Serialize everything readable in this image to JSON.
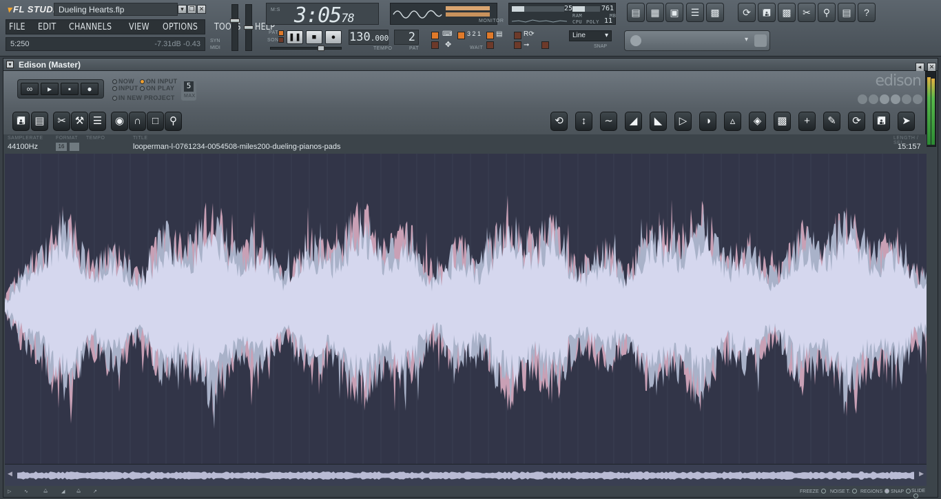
{
  "app": {
    "logo": "FL STUDIO",
    "project": "Dueling Hearts.flp",
    "menu": [
      "FILE",
      "EDIT",
      "CHANNELS",
      "VIEW",
      "OPTIONS",
      "TOOLS",
      "HELP"
    ],
    "hint_position": "5:250",
    "hint_db": "-7.31dB  -0.43",
    "syn_label": "SYN",
    "midi_label": "MIDI"
  },
  "transport": {
    "clock_main": "3:05",
    "clock_sub": "78",
    "tempo_main": "130",
    "tempo_sub": ".000",
    "tempo_label": "TEMPO",
    "pattern": "2",
    "pattern_label": "PAT",
    "pat_label": "PAT",
    "song_label": "SONG",
    "monitor_label": "MONITOR",
    "snap_value": "Line",
    "snap_label": "SNAP",
    "wait_label": "WAIT"
  },
  "performance": {
    "ram_label": "RAM",
    "ram_value": "25",
    "mb_value": "761",
    "mb_label": "MB",
    "cpu_label": "CPU",
    "poly_label": "POLY",
    "poly_value": "11"
  },
  "edison": {
    "window_title": "Edison (Master)",
    "logo": "edison",
    "options": {
      "now": "NOW",
      "input": "INPUT",
      "on_input": "ON INPUT",
      "on_play": "ON PLAY",
      "in_new_project": "IN NEW PROJECT"
    },
    "max_value": "5",
    "max_label": "MAX",
    "info": {
      "samplerate_label": "SAMPLERATE",
      "samplerate": "44100Hz",
      "format_label": "FORMAT",
      "format": "16",
      "tempo_label": "TEMPO",
      "title_label": "TITLE",
      "title": "looperman-l-0761234-0054508-miles200-dueling-pianos-pads",
      "length_label": "LENGTH / SEL",
      "length": "15:157"
    },
    "status": {
      "freeze": "FREEZE",
      "noise": "NOISE T.",
      "regions": "REGIONS",
      "snap": "SNAP",
      "slide": "SLIDE"
    }
  },
  "colors": {
    "wave_main": "#d5d7ee",
    "wave_left": "#c9a0b5",
    "wave_right": "#a9b2c9",
    "background": "#323548",
    "accent": "#f0a030"
  }
}
